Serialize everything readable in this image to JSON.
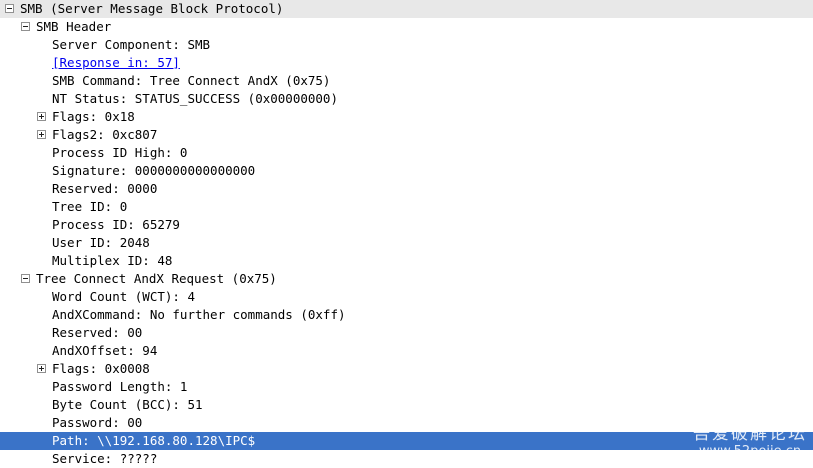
{
  "tree": {
    "smb_root": "SMB (Server Message Block Protocol)",
    "smb_header": {
      "title": "SMB Header",
      "server_component": "Server Component: SMB",
      "response_in": "[Response in: 57]",
      "smb_command": "SMB Command: Tree Connect AndX (0x75)",
      "nt_status": "NT Status: STATUS_SUCCESS (0x00000000)",
      "flags": "Flags: 0x18",
      "flags2": "Flags2: 0xc807",
      "process_id_high": "Process ID High: 0",
      "signature": "Signature: 0000000000000000",
      "reserved": "Reserved: 0000",
      "tree_id": "Tree ID: 0",
      "process_id": "Process ID: 65279",
      "user_id": "User ID: 2048",
      "multiplex_id": "Multiplex ID: 48"
    },
    "tree_connect": {
      "title": "Tree Connect AndX Request (0x75)",
      "word_count": "Word Count (WCT): 4",
      "andx_command": "AndXCommand: No further commands (0xff)",
      "reserved": "Reserved: 00",
      "andx_offset": "AndXOffset: 94",
      "flags": "Flags: 0x0008",
      "password_length": "Password Length: 1",
      "byte_count": "Byte Count (BCC): 51",
      "password": "Password: 00",
      "path": "Path: \\\\192.168.80.128\\IPC$",
      "service": "Service: ?????"
    }
  },
  "watermark": {
    "line1": "吾爱破解论坛",
    "line2": "www.52pojie.cn"
  },
  "colors": {
    "selection": "#3a73c8",
    "header_row": "#e8e8e8",
    "link": "#0000ee"
  }
}
